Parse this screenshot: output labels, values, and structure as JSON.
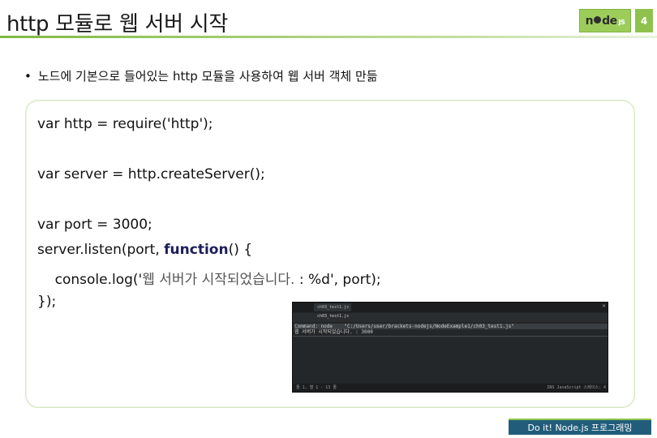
{
  "slide": {
    "title": "http 모듈로 웹 서버 시작",
    "page_number": "4",
    "logo": {
      "text_left": "n",
      "text_right": "de",
      "suffix": "JS"
    },
    "bullet": {
      "glyph": "•",
      "text": "노드에 기본으로 들어있는 http 모듈을 사용하여 웹 서버 객체 만듦"
    },
    "footer": "Do it! Node.js 프로그래밍"
  },
  "code": {
    "line1": {
      "kw": "var",
      "rest": " http = require('http');"
    },
    "line2": {
      "kw": "var",
      "rest": " server = http.createServer();"
    },
    "line3": {
      "kw": "var",
      "rest": " port = 3000;"
    },
    "line4": {
      "pre": "server.listen(port, ",
      "kw": "function",
      "post": "() {"
    },
    "line5": {
      "pre": "    console.log('",
      "kor": "웹 서버가 시작되었습니다.",
      "post": " : %d', port);"
    },
    "line6": {
      "text": "});"
    }
  },
  "screenshot": {
    "tab_active": "ch03_test1.js",
    "tab_inactive": "",
    "file_label": "ch03_test1.js",
    "command_line": "Command: node    \"C:/Users/user/brackets-nodejs/NodeExample1/ch03_test1.js\"",
    "output_line": "웹 서버가 시작되었습니다. : 3000",
    "status_left": "줄 1, 열 1 - 13 줄",
    "status_right": "INS   JavaScript   스페이스: 4"
  },
  "colors": {
    "accent_green": "#8fc24c",
    "footer_blue": "#215d7a",
    "ide_bg": "#242729"
  }
}
